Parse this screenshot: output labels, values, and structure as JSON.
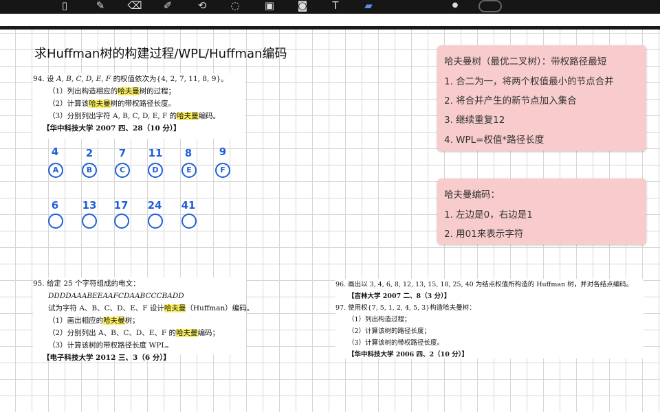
{
  "toolbar": {
    "tools": [
      {
        "icon": "document-icon",
        "glyph": "▯"
      },
      {
        "icon": "pen-icon",
        "glyph": "✎"
      },
      {
        "icon": "eraser-icon",
        "glyph": "⌫"
      },
      {
        "icon": "highlighter-icon",
        "glyph": "✐"
      },
      {
        "icon": "lasso-icon",
        "glyph": "⟲"
      },
      {
        "icon": "shapes-icon",
        "glyph": "◌"
      },
      {
        "icon": "image-icon",
        "glyph": "▣"
      },
      {
        "icon": "camera-icon",
        "glyph": "◙"
      },
      {
        "icon": "text-icon",
        "glyph": "T"
      },
      {
        "icon": "ruler-icon",
        "glyph": "▰"
      }
    ]
  },
  "page": {
    "title": "求Huffman树的构建过程/WPL/Huffman编码"
  },
  "q94": {
    "line1_pre": "94. 设",
    "line1_vars": " A, B, C, D, E, F ",
    "line1_post": "的权值依次为{4, 2, 7, 11, 8, 9}。",
    "l2_pre": "（1）列出构造相应的",
    "l2_hl": "哈夫曼",
    "l2_post": "树的过程；",
    "l3_pre": "（2）计算该",
    "l3_hl": "哈夫曼",
    "l3_post": "树的带权路径长度。",
    "l4_pre": "（3）分别列出字符 A, B, C, D, E, F 的",
    "l4_hl": "哈夫曼",
    "l4_post": "编码。",
    "source": "【华中科技大学  2007  四、28（10 分）】"
  },
  "handwriting": {
    "weights": [
      "4",
      "2",
      "7",
      "11",
      "8",
      "9"
    ],
    "letters": [
      "A",
      "B",
      "C",
      "D",
      "E",
      "F"
    ],
    "merged": [
      "6",
      "13",
      "17",
      "24",
      "41"
    ]
  },
  "q95": {
    "line1": "95. 给定 25 个字符组成的电文：",
    "line2": "DDDDAAABEEAAFCDAABCCCBADD",
    "l3_pre": "试为字符 A、B、C、D、E、F 设计",
    "l3_hl": "哈夫曼",
    "l3_post": "（Huffman）编码。",
    "l4_pre": "（1）画出相应的",
    "l4_hl": "哈夫曼",
    "l4_post": "树；",
    "l5_pre": "（2）分别列出 A、B、C、D、E、F 的",
    "l5_hl": "哈夫曼",
    "l5_post": "编码；",
    "l6": "（3）计算该树的带权路径长度 WPL。",
    "source": "【电子科技大学  2012  三、3（6 分）】"
  },
  "q96": {
    "line1": "96. 画出以 3, 4, 6, 8, 12, 13, 15, 18, 25, 40 为结点权值所构造的 Huffman 树，并对各结点编码。",
    "source": "【吉林大学  2007  二、8（3 分）】"
  },
  "q97": {
    "line1": "97. 使用权{7, 5, 1, 2, 4, 5, 3}构造哈夫曼树：",
    "l2": "（1）列出构造过程；",
    "l3": "（2）计算该树的路径长度；",
    "l4": "（3）计算该树的带权路径长度。",
    "source": "【华中科技大学  2006  四、2（10 分）】"
  },
  "note1": {
    "heading": "哈夫曼树（最优二叉树）：带权路径最短",
    "items": [
      "1.  合二为一，将两个权值最小的节点合并",
      "2. 将合并产生的新节点加入集合",
      "3. 继续重复12",
      "4. WPL=权值*路径长度"
    ]
  },
  "note2": {
    "heading": "哈夫曼编码：",
    "items": [
      "1.  左边是0，右边是1",
      "2. 用01来表示字符"
    ]
  },
  "colors": {
    "note_bg": "#f8cccc",
    "highlight": "#fbf062",
    "ink": "#1f5fd6"
  }
}
